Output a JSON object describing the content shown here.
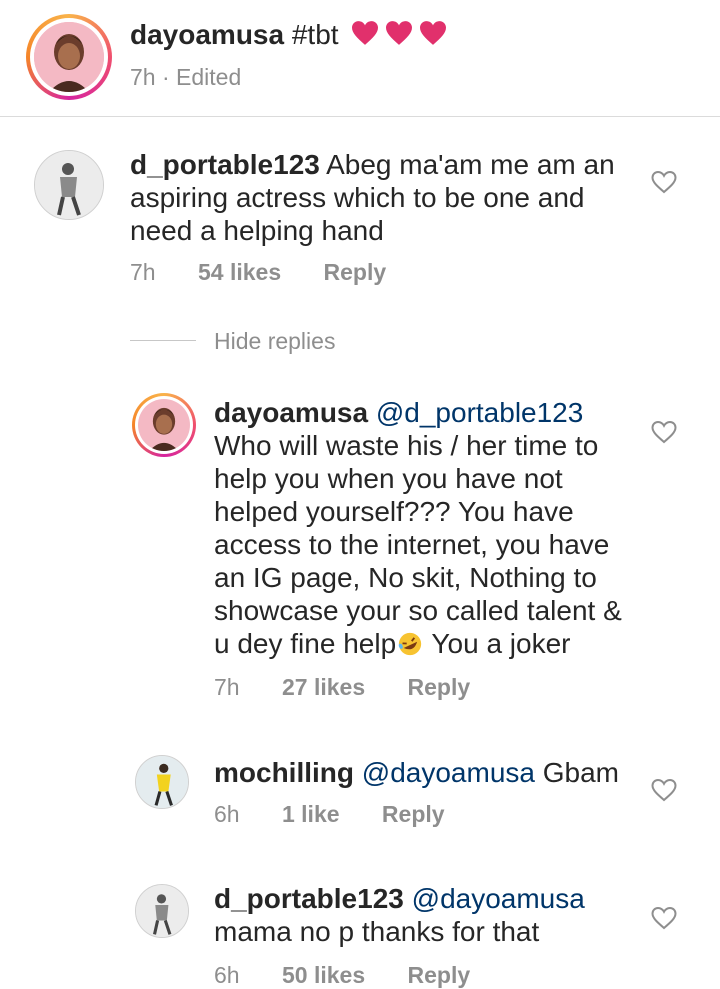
{
  "post": {
    "username": "dayoamusa",
    "caption": "#tbt",
    "emoji_hearts": [
      "pink-heart-icon",
      "pink-heart-icon",
      "pink-heart-icon"
    ],
    "time": "7h",
    "edited": "Edited",
    "separator": "·"
  },
  "comments": [
    {
      "username": "d_portable123",
      "text": "Abeg ma'am me am an aspiring actress which to be one and need a helping hand",
      "time": "7h",
      "likes": "54 likes",
      "reply": "Reply"
    }
  ],
  "hide_replies": "Hide replies",
  "replies": [
    {
      "username": "dayoamusa",
      "mention": "@d_portable123",
      "text": "Who will waste his / her time to help you when you have not helped yourself??? You have access to the internet, you have an IG page, No skit, Nothing to showcase your so called talent & u dey fine help",
      "text_after_emoji": " You a joker",
      "emoji": "rolling-laughing-emoji",
      "time": "7h",
      "likes": "27 likes",
      "reply": "Reply"
    },
    {
      "username": "mochilling",
      "mention": "@dayoamusa",
      "text": "Gbam",
      "time": "6h",
      "likes": "1 like",
      "reply": "Reply"
    },
    {
      "username": "d_portable123",
      "mention": "@dayoamusa",
      "text": "mama no p thanks for that",
      "time": "6h",
      "likes": "50 likes",
      "reply": "Reply"
    }
  ],
  "colors": {
    "text": "#262626",
    "secondary": "#8e8e8e",
    "mention": "#003569",
    "caption_heart": "#e1306c",
    "divider": "#dbdbdb"
  }
}
